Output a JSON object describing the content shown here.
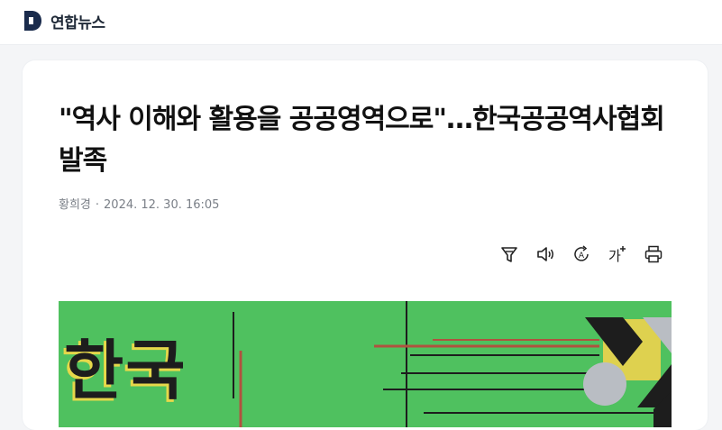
{
  "header": {
    "logo_letter": "D",
    "brand": "연합뉴스"
  },
  "article": {
    "headline": "\"역사 이해와 활용을 공공영역으로\"…한국공공역사협회 발족",
    "author": "황희경",
    "separator": "·",
    "datetime": "2024. 12. 30. 16:05"
  },
  "toolbar": {
    "icons": [
      "summary-icon",
      "listen-icon",
      "translate-icon",
      "font-size-icon",
      "print-icon"
    ],
    "translate_glyph": "A",
    "font_size_glyph": "가"
  },
  "photo": {
    "visible_text": "한국",
    "background_color": "#4fc15f"
  },
  "colors": {
    "page_bg": "#f4f5f7",
    "card_bg": "#ffffff",
    "logo": "#1a2b4c",
    "byline": "#7a7f87"
  }
}
